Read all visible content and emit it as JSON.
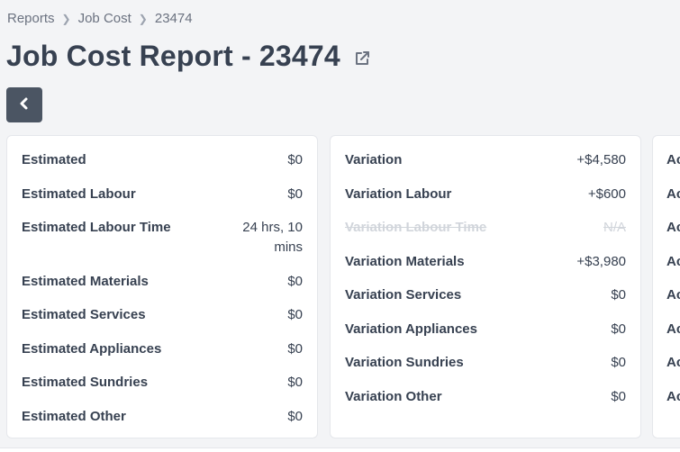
{
  "breadcrumb": {
    "items": [
      "Reports",
      "Job Cost",
      "23474"
    ]
  },
  "page": {
    "title": "Job Cost Report - 23474"
  },
  "icons": {
    "external_link": "external-link-icon",
    "back": "chevron-left-icon",
    "breadcrumb_separator": "chevron-right-icon"
  },
  "colors": {
    "back_button": "#4b5563",
    "background": "#f3f4f6"
  },
  "estimated": {
    "rows": [
      {
        "label": "Estimated",
        "value": "$0"
      },
      {
        "label": "Estimated Labour",
        "value": "$0"
      },
      {
        "label": "Estimated Labour Time",
        "value": "24 hrs, 10 mins"
      },
      {
        "label": "Estimated Materials",
        "value": "$0"
      },
      {
        "label": "Estimated Services",
        "value": "$0"
      },
      {
        "label": "Estimated Appliances",
        "value": "$0"
      },
      {
        "label": "Estimated Sundries",
        "value": "$0"
      },
      {
        "label": "Estimated Other",
        "value": "$0"
      }
    ]
  },
  "variation": {
    "rows": [
      {
        "label": "Variation",
        "value": "+$4,580"
      },
      {
        "label": "Variation Labour",
        "value": "+$600"
      },
      {
        "label": "Variation Labour Time",
        "value": "N/A"
      },
      {
        "label": "Variation Materials",
        "value": "+$3,980"
      },
      {
        "label": "Variation Services",
        "value": "$0"
      },
      {
        "label": "Variation Appliances",
        "value": "$0"
      },
      {
        "label": "Variation Sundries",
        "value": "$0"
      },
      {
        "label": "Variation Other",
        "value": "$0"
      }
    ]
  },
  "actual": {
    "rows": [
      {
        "label": "Ac"
      },
      {
        "label": "Ac"
      },
      {
        "label": "Ac"
      },
      {
        "label": "Ac"
      },
      {
        "label": "Ac"
      },
      {
        "label": "Ac"
      },
      {
        "label": "Ac"
      },
      {
        "label": "Ac"
      }
    ]
  }
}
